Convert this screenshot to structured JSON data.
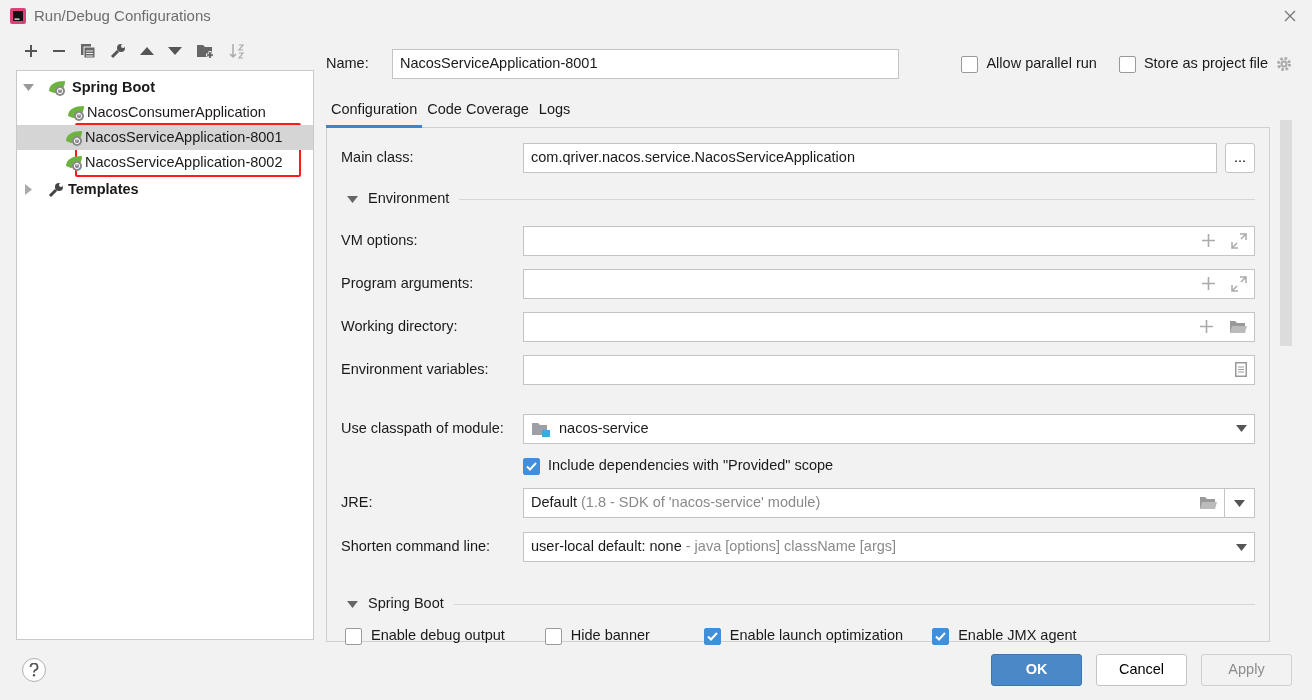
{
  "window": {
    "title": "Run/Debug Configurations"
  },
  "tree": [
    {
      "label": "Spring Boot",
      "kind": "group",
      "expanded": true,
      "children": [
        {
          "label": "NacosConsumerApplication",
          "selected": false,
          "annotated": false
        },
        {
          "label": "NacosServiceApplication-8001",
          "selected": true,
          "annotated": true
        },
        {
          "label": "NacosServiceApplication-8002",
          "selected": false,
          "annotated": true
        }
      ]
    },
    {
      "label": "Templates",
      "kind": "templates",
      "expanded": false
    }
  ],
  "name_field": {
    "label": "Name:",
    "value": "NacosServiceApplication-8001"
  },
  "options": [
    {
      "label": "Allow parallel run",
      "checked": false
    },
    {
      "label": "Store as project file",
      "checked": false
    }
  ],
  "tabs": [
    {
      "label": "Configuration",
      "selected": true
    },
    {
      "label": "Code Coverage",
      "selected": false
    },
    {
      "label": "Logs",
      "selected": false
    }
  ],
  "main_class": {
    "label": "Main class:",
    "value": "com.qriver.nacos.service.NacosServiceApplication",
    "button": "..."
  },
  "environment": {
    "title": "Environment",
    "expanded": true,
    "fields": [
      {
        "label": "VM options:",
        "kind": "expandable"
      },
      {
        "label": "Program arguments:",
        "kind": "expandable"
      },
      {
        "label": "Working directory:",
        "kind": "directory"
      },
      {
        "label": "Environment variables:",
        "kind": "variables"
      }
    ]
  },
  "module": {
    "label": "Use classpath of module:",
    "value": "nacos-service"
  },
  "include_provided": {
    "label": "Include dependencies with \"Provided\" scope",
    "checked": true
  },
  "jre": {
    "label": "JRE:",
    "value": "Default",
    "hint": "(1.8 - SDK of 'nacos-service' module)"
  },
  "shorten": {
    "label": "Shorten command line:",
    "value": "user-local default: none",
    "hint": "- java [options] className [args]"
  },
  "spring_boot": {
    "title": "Spring Boot",
    "expanded": true,
    "options": [
      {
        "label": "Enable debug output",
        "checked": false
      },
      {
        "label": "Hide banner",
        "checked": false
      },
      {
        "label": "Enable launch optimization",
        "checked": true
      },
      {
        "label": "Enable JMX agent",
        "checked": true
      }
    ]
  },
  "buttons": [
    {
      "label": "OK",
      "kind": "primary",
      "disabled": false
    },
    {
      "label": "Cancel",
      "kind": "default",
      "disabled": false
    },
    {
      "label": "Apply",
      "kind": "default",
      "disabled": true
    }
  ]
}
